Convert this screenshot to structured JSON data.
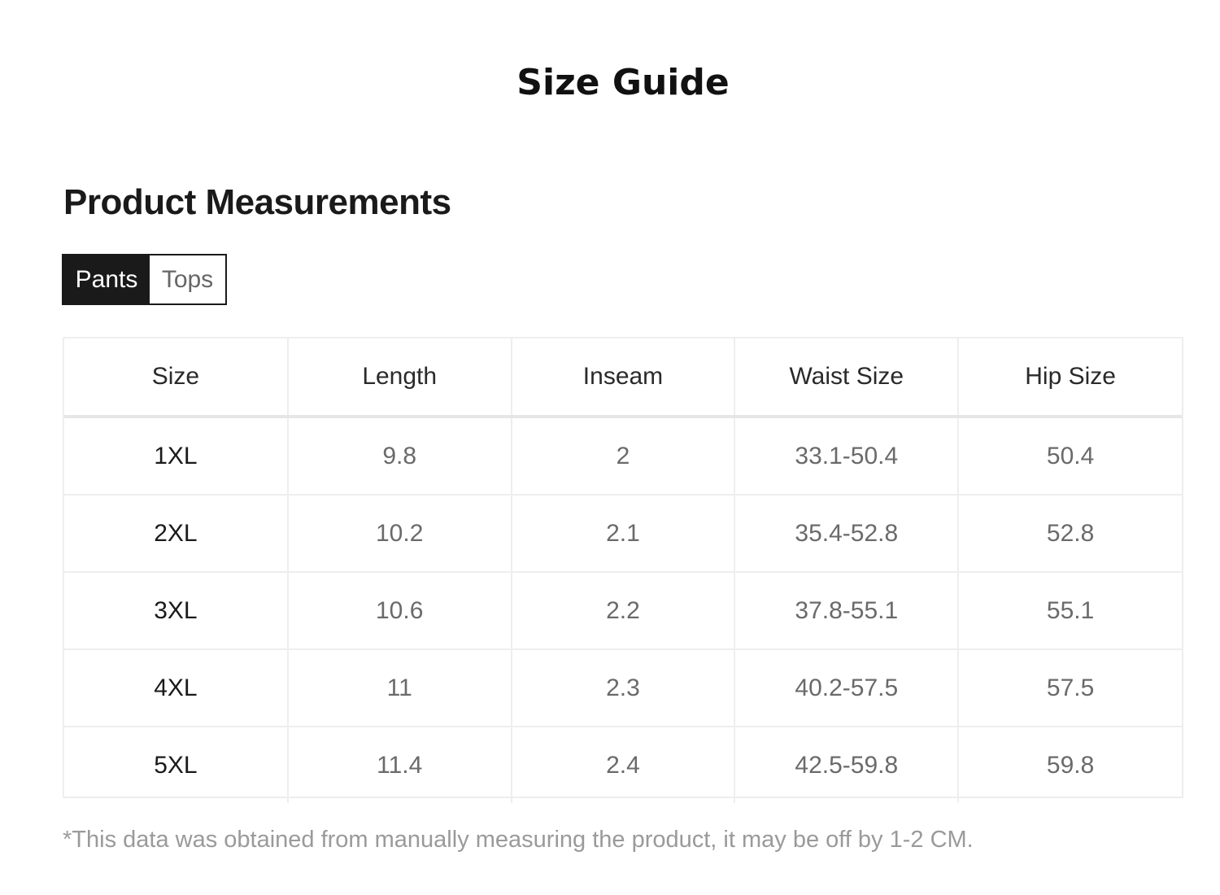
{
  "page": {
    "title": "Size Guide",
    "section_title": "Product Measurements"
  },
  "tabs": [
    {
      "label": "Pants",
      "active": true
    },
    {
      "label": "Tops",
      "active": false
    }
  ],
  "table": {
    "headers": [
      "Size",
      "Length",
      "Inseam",
      "Waist Size",
      "Hip Size"
    ],
    "rows": [
      [
        "1XL",
        "9.8",
        "2",
        "33.1-50.4",
        "50.4"
      ],
      [
        "2XL",
        "10.2",
        "2.1",
        "35.4-52.8",
        "52.8"
      ],
      [
        "3XL",
        "10.6",
        "2.2",
        "37.8-55.1",
        "55.1"
      ],
      [
        "4XL",
        "11",
        "2.3",
        "40.2-57.5",
        "57.5"
      ],
      [
        "5XL",
        "11.4",
        "2.4",
        "42.5-59.8",
        "59.8"
      ]
    ]
  },
  "footnote": "*This data was obtained from manually measuring the product, it may be off by 1-2 CM.",
  "colors": {
    "active_tab_bg": "#1a1a1a",
    "table_border": "#eeeeee",
    "footnote_text": "#9a9a9a"
  }
}
